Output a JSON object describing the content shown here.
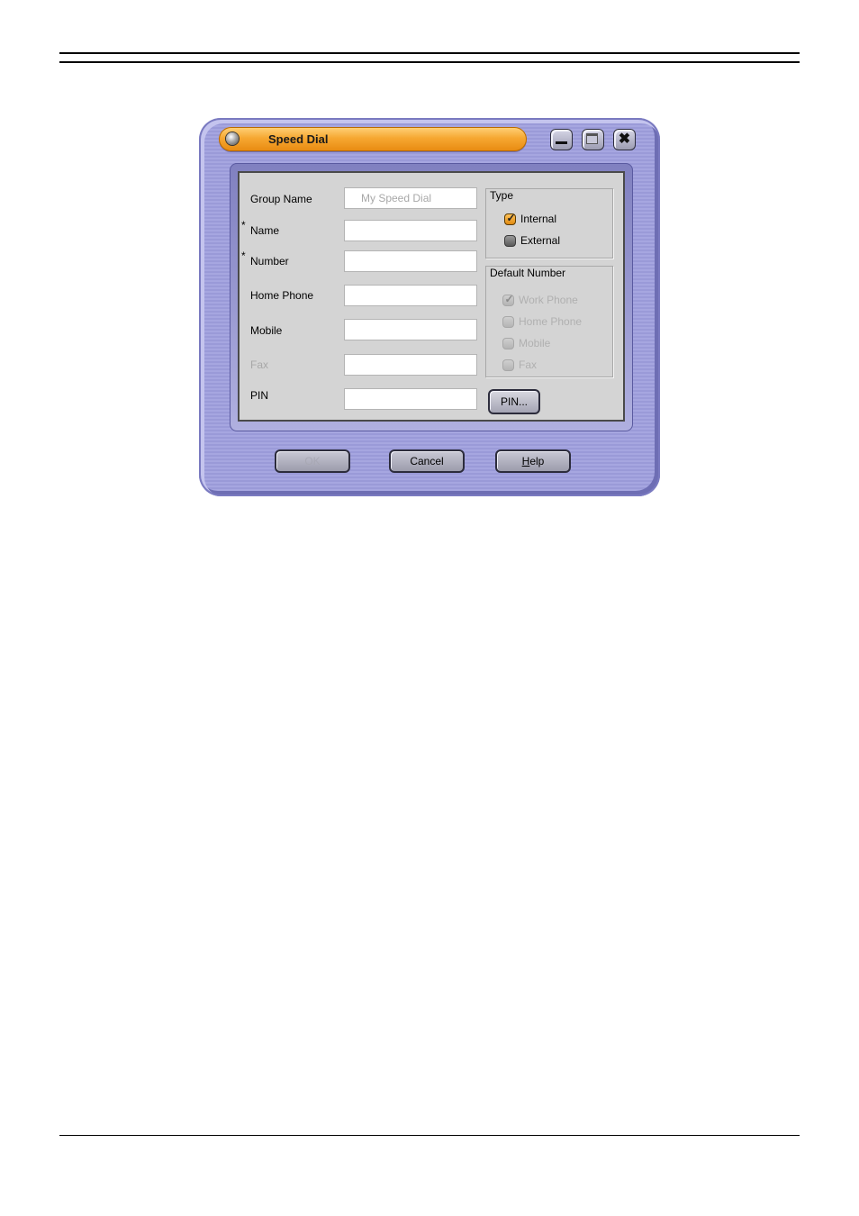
{
  "window": {
    "title": "Speed Dial",
    "controls": {
      "minimize": "minimize",
      "maximize": "maximize",
      "close": "✖"
    }
  },
  "form": {
    "group_name": {
      "label": "Group Name",
      "value": "My Speed Dial"
    },
    "name": {
      "label": "Name",
      "required_mark": "*",
      "value": ""
    },
    "number": {
      "label": "Number",
      "required_mark": "*",
      "value": ""
    },
    "home_phone": {
      "label": "Home Phone",
      "value": ""
    },
    "mobile": {
      "label": "Mobile",
      "value": ""
    },
    "fax": {
      "label": "Fax",
      "value": ""
    },
    "pin": {
      "label": "PIN",
      "value": ""
    }
  },
  "type_group": {
    "title": "Type",
    "options": [
      {
        "label": "Internal",
        "checked": true,
        "enabled": true
      },
      {
        "label": "External",
        "checked": false,
        "enabled": true
      }
    ]
  },
  "default_number_group": {
    "title": "Default Number",
    "options": [
      {
        "label": "Work Phone",
        "checked": true,
        "enabled": false
      },
      {
        "label": "Home Phone",
        "checked": false,
        "enabled": false
      },
      {
        "label": "Mobile",
        "checked": false,
        "enabled": false
      },
      {
        "label": "Fax",
        "checked": false,
        "enabled": false
      }
    ]
  },
  "buttons": {
    "pin": "PIN...",
    "ok": "OK",
    "cancel": "Cancel",
    "help": "Help"
  },
  "colors": {
    "title_accent": "#f6a832",
    "window_skin": "#9a9ad8",
    "panel": "#d4d4d4"
  }
}
